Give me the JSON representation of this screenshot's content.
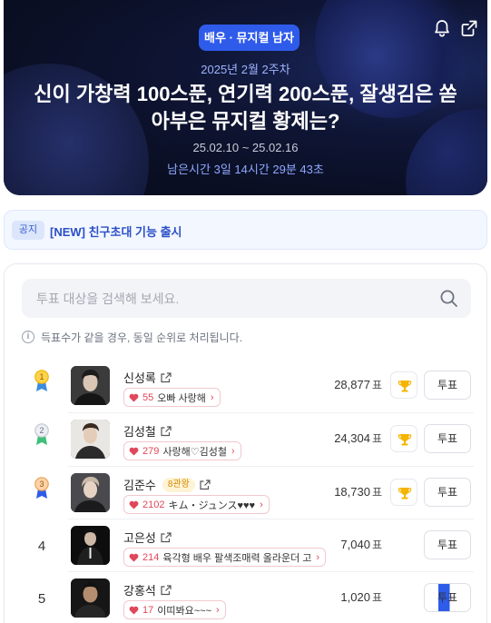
{
  "banner": {
    "category": "배우 · 뮤지컬 남자",
    "week": "2025년 2월 2주차",
    "title": "신이 가창력 100스푼, 연기력 200스푼, 잘생김은 쏟아부은 뮤지컬 황제는?",
    "period": "25.02.10 ~ 25.02.16",
    "remaining": "남은시간 3일 14시간 29분 43초",
    "icons": [
      "bell-icon",
      "share-icon"
    ]
  },
  "notice": {
    "tag": "공지",
    "text": "[NEW] 친구초대 기능 출시"
  },
  "search": {
    "placeholder": "투표 대상을 검색해 보세요."
  },
  "info": {
    "text": "득표수가 같을 경우, 동일 순위로 처리됩니다."
  },
  "list": {
    "vote_label": "투표",
    "unit": "표",
    "items": [
      {
        "rank": "1",
        "name": "신성록",
        "badge": "",
        "cheer_count": "55",
        "cheer_msg": "오빠 사랑해",
        "votes": "28,877",
        "medal": "gold"
      },
      {
        "rank": "2",
        "name": "김성철",
        "badge": "",
        "cheer_count": "279",
        "cheer_msg": "사랑해♡김성철",
        "votes": "24,304",
        "medal": "silver"
      },
      {
        "rank": "3",
        "name": "김준수",
        "badge": "8관왕",
        "cheer_count": "2102",
        "cheer_msg": "キム・ジュンス♥♥♥",
        "votes": "18,730",
        "medal": "bronze"
      },
      {
        "rank": "4",
        "name": "고은성",
        "badge": "",
        "cheer_count": "214",
        "cheer_msg": "육각형 배우 팔색조매력 올라운더 고",
        "votes": "7,040",
        "medal": ""
      },
      {
        "rank": "5",
        "name": "강홍석",
        "badge": "",
        "cheer_count": "17",
        "cheer_msg": "이띠봐요~~~",
        "votes": "1,020",
        "medal": ""
      }
    ]
  },
  "colors": {
    "accent": "#2f5bea",
    "heart": "#e0475a",
    "gold": "#f5b400"
  }
}
